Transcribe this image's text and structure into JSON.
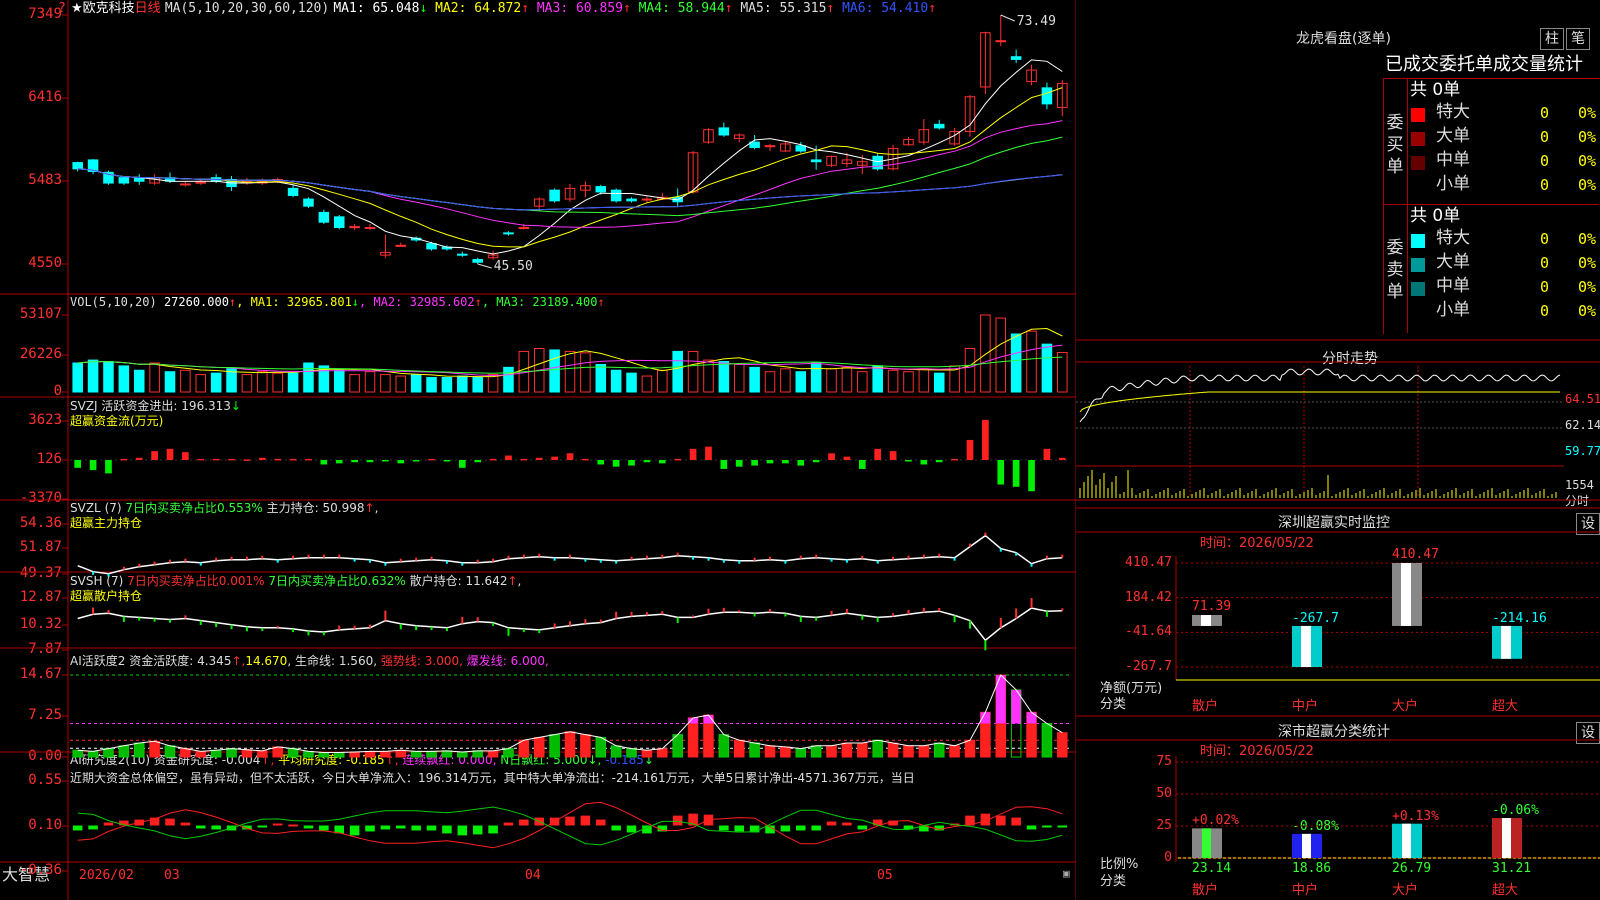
{
  "stock": {
    "star": "★",
    "name": "欧克科技",
    "period": "日线"
  },
  "main_panel": {
    "ma_title": "MA(5,10,20,30,60,120)",
    "ma": [
      {
        "label": "MA1:",
        "value": "65.048",
        "arrow": "↓",
        "color": "#ffffff"
      },
      {
        "label": "MA2:",
        "value": "64.872",
        "arrow": "↑",
        "color": "#ffff00"
      },
      {
        "label": "MA3:",
        "value": "60.859",
        "arrow": "↑",
        "color": "#ff33ff"
      },
      {
        "label": "MA4:",
        "value": "58.944",
        "arrow": "↑",
        "color": "#33ff33"
      },
      {
        "label": "MA5:",
        "value": "55.315",
        "arrow": "↑",
        "color": "#dddddd"
      },
      {
        "label": "MA6:",
        "value": "54.410",
        "arrow": "↑",
        "color": "#3355ff"
      }
    ],
    "yticks": [
      "7349",
      "6416",
      "5483",
      "4550"
    ],
    "high_label": "73.49",
    "low_label": "45.50"
  },
  "vol_panel": {
    "title": "VOL(5,10,20)",
    "value": "27260.000",
    "value_arrow": "↑",
    "ma": [
      {
        "label": "MA1:",
        "value": "32965.801",
        "arrow": "↓",
        "color": "#ffff00"
      },
      {
        "label": "MA2:",
        "value": "32985.602",
        "arrow": "↑",
        "color": "#ff33ff"
      },
      {
        "label": "MA3:",
        "value": "23189.400",
        "arrow": "↑",
        "color": "#33ff33"
      }
    ],
    "yticks": [
      "53107",
      "26226",
      "0"
    ]
  },
  "svzj_panel": {
    "code": "SVZJ",
    "label": "活跃资金进出:",
    "value": "196.313",
    "arrow": "↓",
    "subtitle": "超赢资金流(万元)",
    "yticks": [
      "3623",
      "126",
      "-3370"
    ]
  },
  "svzl_panel": {
    "code": "SVZL",
    "param": "(7)",
    "part1": "7日内买卖净占比0.553%",
    "part2": "主力持仓:",
    "value": "50.998",
    "arrow": "↑",
    "tail": ",",
    "subtitle": "超赢主力持仓",
    "yticks": [
      "54.36",
      "51.87",
      "49.37"
    ]
  },
  "svsh_panel": {
    "code": "SVSH",
    "param": "(7)",
    "part1": "7日内买卖净占比0.001%",
    "part2": "7日内买卖净占比0.632%",
    "part3": "散户持仓:",
    "value": "11.642",
    "arrow": "↑",
    "tail": ",",
    "subtitle": "超赢散户持仓",
    "yticks": [
      "12.87",
      "10.32",
      "7.87"
    ]
  },
  "ai_active_panel": {
    "title": "AI活跃度2",
    "label1": "资金活跃度:",
    "value1": "4.345",
    "value2": "14.670",
    "label3": "生命线:",
    "value3": "1.560",
    "label4": "强势线:",
    "value4": "3.000",
    "label5": "爆发线:",
    "value5": "6.000",
    "yticks": [
      "14.67",
      "7.25",
      "0.00"
    ]
  },
  "ai_research_panel": {
    "title": "AI研究度2(10)",
    "label1": "资金研究度:",
    "value1": "-0.004",
    "label2": "平均研究度:",
    "value2": "-0.185",
    "label3": "连续飘红:",
    "value3": "0.000",
    "label4": "N日飘红:",
    "value4": "5.000",
    "value5": "-0.185",
    "commentary": "近期大资金总体偏空，虽有异动，但不太活跃，今日大单净流入：196.314万元，其中特大单净流出：-214.161万元，大单5日累计净出-4571.367万元，当日",
    "yticks": [
      "0.55",
      "0.10",
      "-0.36"
    ]
  },
  "bottom_bar": {
    "brand": "大智慧",
    "dates": [
      "2026/02",
      "03",
      "04",
      "05"
    ]
  },
  "dragon": {
    "title": "龙虎看盘(逐单)",
    "btn_bar": "柱",
    "btn_pen": "笔",
    "header": "已成交委托单成交量统计",
    "buy_label": "委买单",
    "sell_label": "委卖单",
    "buy_total": "共 0单",
    "sell_total": "共 0单",
    "buy_rows": [
      {
        "name": "特大",
        "count": "0",
        "pct": "0%",
        "color": "#ff0000"
      },
      {
        "name": "大单",
        "count": "0",
        "pct": "0%",
        "color": "#990000"
      },
      {
        "name": "中单",
        "count": "0",
        "pct": "0%",
        "color": "#660000"
      },
      {
        "name": "小单",
        "count": "0",
        "pct": "0%",
        "color": ""
      }
    ],
    "sell_rows": [
      {
        "name": "特大",
        "count": "0",
        "pct": "0%",
        "color": "#00ffff"
      },
      {
        "name": "大单",
        "count": "0",
        "pct": "0%",
        "color": "#009999"
      },
      {
        "name": "中单",
        "count": "0",
        "pct": "0%",
        "color": "#007777"
      },
      {
        "name": "小单",
        "count": "0",
        "pct": "0%",
        "color": ""
      }
    ]
  },
  "intraday": {
    "title": "分时走势",
    "prices": [
      "64.51",
      "62.14",
      "59.77"
    ],
    "vol": "1554",
    "vol_unit": "分时"
  },
  "sz_monitor": {
    "title": "深圳超赢实时监控",
    "btn": "设",
    "time_label": "时间：2026/05/22",
    "yticks": [
      "410.47",
      "184.42",
      "-41.64",
      "-267.7"
    ],
    "axis_label": "净额(万元)",
    "axis_label2": "分类",
    "bars": [
      {
        "category": "散户",
        "value": 71.39,
        "label": "71.39"
      },
      {
        "category": "中户",
        "value": -267.7,
        "label": "-267.7"
      },
      {
        "category": "大户",
        "value": 410.47,
        "label": "410.47"
      },
      {
        "category": "超大",
        "value": -214.16,
        "label": "-214.16"
      }
    ]
  },
  "sz_class": {
    "title": "深市超赢分类统计",
    "btn": "设",
    "time_label": "时间：2026/05/22",
    "yticks": [
      "75",
      "50",
      "25",
      "0"
    ],
    "axis_label": "比例%",
    "axis_label2": "分类",
    "bars": [
      {
        "category": "散户",
        "value": 23.14,
        "label": "23.14",
        "change": "+0.02%"
      },
      {
        "category": "中户",
        "value": 18.86,
        "label": "18.86",
        "change": "-0.08%"
      },
      {
        "category": "大户",
        "value": 26.79,
        "label": "26.79",
        "change": "+0.13%"
      },
      {
        "category": "超大",
        "value": 31.21,
        "label": "31.21",
        "change": "-0.06%"
      }
    ]
  },
  "chart_data": [
    {
      "type": "candlestick",
      "title": "欧克科技 日线",
      "note": "values estimated from axis (price x100 scale shown on axis)",
      "x": [
        "2026/02",
        "03",
        "04",
        "05"
      ],
      "ylim": [
        4550,
        7349
      ],
      "ohlc": [
        [
          5690,
          5700,
          5590,
          5620
        ],
        [
          5720,
          5730,
          5560,
          5590
        ],
        [
          5580,
          5600,
          5440,
          5460
        ],
        [
          5520,
          5530,
          5440,
          5460
        ],
        [
          5520,
          5560,
          5440,
          5480
        ],
        [
          5460,
          5560,
          5440,
          5520
        ],
        [
          5520,
          5580,
          5460,
          5480
        ],
        [
          5440,
          5480,
          5420,
          5450
        ],
        [
          5460,
          5500,
          5440,
          5470
        ],
        [
          5520,
          5560,
          5460,
          5480
        ],
        [
          5500,
          5540,
          5370,
          5420
        ],
        [
          5460,
          5520,
          5440,
          5480
        ],
        [
          5460,
          5510,
          5440,
          5480
        ],
        [
          5480,
          5520,
          5460,
          5500
        ],
        [
          5400,
          5440,
          5300,
          5320
        ],
        [
          5280,
          5300,
          5180,
          5200
        ],
        [
          5130,
          5160,
          5000,
          5020
        ],
        [
          5080,
          5100,
          4940,
          4960
        ],
        [
          4960,
          5000,
          4930,
          4970
        ],
        [
          4950,
          5000,
          4930,
          4960
        ],
        [
          4650,
          4880,
          4620,
          4680
        ],
        [
          4760,
          4790,
          4740,
          4760
        ],
        [
          4840,
          4860,
          4800,
          4820
        ],
        [
          4780,
          4800,
          4700,
          4720
        ],
        [
          4740,
          4760,
          4700,
          4720
        ],
        [
          4660,
          4690,
          4630,
          4650
        ],
        [
          4600,
          4620,
          4550,
          4570
        ],
        [
          4620,
          4700,
          4600,
          4650
        ],
        [
          4900,
          4920,
          4870,
          4890
        ],
        [
          4960,
          5000,
          4940,
          4960
        ],
        [
          5200,
          5300,
          5150,
          5280
        ],
        [
          5380,
          5400,
          5240,
          5260
        ],
        [
          5280,
          5450,
          5250,
          5400
        ],
        [
          5380,
          5480,
          5300,
          5430
        ],
        [
          5420,
          5440,
          5330,
          5360
        ],
        [
          5380,
          5400,
          5240,
          5260
        ],
        [
          5280,
          5300,
          5240,
          5260
        ],
        [
          5270,
          5310,
          5240,
          5280
        ],
        [
          5280,
          5350,
          5270,
          5300
        ],
        [
          5300,
          5400,
          5200,
          5250
        ],
        [
          5360,
          5820,
          5340,
          5800
        ],
        [
          5920,
          6080,
          5900,
          6060
        ],
        [
          6080,
          6140,
          5980,
          6000
        ],
        [
          5960,
          6020,
          5920,
          6000
        ],
        [
          5920,
          6000,
          5840,
          5860
        ],
        [
          5880,
          5900,
          5820,
          5880
        ],
        [
          5820,
          5930,
          5810,
          5900
        ],
        [
          5880,
          5920,
          5800,
          5820
        ],
        [
          5720,
          5880,
          5610,
          5700
        ],
        [
          5660,
          5770,
          5640,
          5760
        ],
        [
          5680,
          5800,
          5640,
          5720
        ],
        [
          5660,
          5780,
          5560,
          5700
        ],
        [
          5760,
          5800,
          5600,
          5620
        ],
        [
          5620,
          5890,
          5600,
          5850
        ],
        [
          5890,
          5980,
          5880,
          5950
        ],
        [
          5920,
          6180,
          5890,
          6060
        ],
        [
          6120,
          6170,
          6060,
          6080
        ],
        [
          5900,
          6080,
          5880,
          6040
        ],
        [
          6040,
          6450,
          5980,
          6430
        ],
        [
          6540,
          7160,
          6460,
          7150
        ],
        [
          7050,
          7349,
          7000,
          7060
        ],
        [
          6880,
          6960,
          6810,
          6850
        ],
        [
          6600,
          6790,
          6560,
          6730
        ],
        [
          6530,
          6590,
          6290,
          6350
        ],
        [
          6310,
          6620,
          6210,
          6580
        ]
      ]
    },
    {
      "type": "bar",
      "title": "VOL(5,10,20)",
      "ylim": [
        0,
        53107
      ],
      "values": [
        20000,
        22000,
        21000,
        18000,
        15000,
        20000,
        14000,
        15000,
        12000,
        13000,
        16000,
        12000,
        14000,
        13000,
        13000,
        20000,
        18000,
        15000,
        12000,
        14000,
        12000,
        11000,
        12000,
        10000,
        10000,
        11000,
        10000,
        12000,
        17000,
        28000,
        30000,
        29000,
        28000,
        27000,
        19000,
        15000,
        13000,
        11000,
        15000,
        28000,
        28000,
        22000,
        21000,
        19000,
        17000,
        14000,
        16000,
        14000,
        20000,
        16000,
        17000,
        14000,
        18000,
        15000,
        14000,
        16000,
        13000,
        18000,
        30000,
        53107,
        51000,
        40000,
        42000,
        33000,
        27260
      ]
    },
    {
      "type": "bar",
      "title": "SVZJ 活跃资金进出",
      "ylim": [
        -3370,
        3623
      ],
      "values": [
        -700,
        -900,
        -1200,
        100,
        200,
        800,
        1000,
        700,
        100,
        100,
        100,
        50,
        200,
        100,
        100,
        100,
        -400,
        -300,
        -200,
        -200,
        -100,
        -300,
        -50,
        100,
        -100,
        -700,
        -200,
        100,
        400,
        100,
        200,
        300,
        600,
        100,
        -400,
        -600,
        -500,
        -200,
        -300,
        100,
        1000,
        1200,
        -800,
        -600,
        -500,
        -300,
        -300,
        -500,
        -200,
        600,
        300,
        -800,
        1000,
        800,
        -100,
        -400,
        -200,
        100,
        1800,
        3600,
        -2200,
        -2400,
        -2800,
        1000,
        196
      ]
    },
    {
      "type": "line",
      "title": "SVZL 主力持仓",
      "ylim": [
        49.37,
        54.36
      ],
      "values": [
        50.2,
        49.6,
        49.4,
        49.8,
        50.1,
        50.3,
        50.5,
        50.6,
        50.5,
        50.7,
        50.8,
        50.8,
        50.9,
        50.8,
        50.9,
        51.0,
        51.0,
        51.0,
        50.9,
        50.8,
        50.5,
        50.6,
        50.7,
        50.8,
        50.7,
        50.5,
        50.5,
        50.6,
        50.9,
        51.0,
        51.1,
        51.0,
        51.0,
        50.9,
        50.8,
        50.7,
        50.8,
        50.9,
        51.0,
        51.2,
        51.1,
        51.0,
        50.8,
        50.7,
        50.7,
        50.8,
        50.7,
        50.9,
        51.0,
        50.9,
        50.8,
        50.9,
        50.7,
        50.8,
        50.9,
        51.0,
        51.1,
        51.0,
        52.1,
        53.2,
        51.9,
        51.5,
        50.4,
        50.9,
        51.0
      ]
    },
    {
      "type": "line",
      "title": "SVSH 散户持仓",
      "ylim": [
        7.87,
        12.87
      ],
      "values": [
        10.9,
        11.3,
        11.4,
        11.1,
        11.0,
        10.9,
        10.8,
        10.9,
        10.7,
        10.5,
        10.3,
        10.1,
        10.0,
        10.0,
        9.9,
        9.7,
        9.6,
        9.8,
        9.9,
        10.0,
        10.7,
        10.4,
        10.2,
        10.1,
        10.0,
        10.4,
        10.6,
        10.5,
        10.0,
        9.9,
        9.8,
        10.0,
        10.2,
        10.4,
        10.5,
        10.9,
        11.1,
        11.2,
        11.3,
        11.0,
        11.0,
        11.3,
        11.5,
        11.5,
        11.4,
        11.5,
        11.4,
        11.1,
        11.0,
        11.2,
        11.4,
        11.2,
        11.0,
        11.1,
        11.3,
        11.5,
        11.6,
        11.2,
        10.7,
        8.8,
        10.0,
        10.9,
        11.9,
        11.6,
        11.642
      ]
    },
    {
      "type": "bar",
      "title": "AI活跃度2 资金活跃度",
      "ylim": [
        0,
        14.67
      ],
      "values": [
        1.2,
        1.0,
        1.5,
        2.0,
        2.5,
        2.8,
        2.0,
        1.5,
        1.0,
        1.2,
        1.5,
        1.3,
        1.1,
        1.8,
        1.5,
        1.0,
        0.8,
        0.8,
        0.9,
        1.0,
        1.0,
        1.2,
        1.0,
        1.0,
        1.1,
        0.9,
        1.1,
        1.1,
        1.5,
        3.0,
        3.5,
        4.0,
        4.5,
        4.0,
        3.5,
        2.0,
        1.5,
        1.2,
        1.5,
        4.0,
        7.0,
        7.5,
        4.0,
        3.0,
        2.5,
        2.0,
        1.8,
        1.5,
        2.0,
        2.0,
        2.5,
        2.5,
        3.0,
        2.5,
        2.0,
        2.0,
        2.5,
        2.0,
        3.0,
        8.0,
        14.67,
        12.0,
        8.0,
        6.0,
        4.345
      ]
    },
    {
      "type": "bar",
      "title": "AI研究度2 资金研究度",
      "ylim": [
        -0.36,
        0.55
      ],
      "values": [
        -0.05,
        -0.04,
        0.03,
        0.05,
        0.06,
        0.08,
        0.07,
        0.03,
        -0.03,
        -0.04,
        -0.05,
        -0.04,
        -0.02,
        0.02,
        0.01,
        -0.03,
        -0.05,
        -0.08,
        -0.1,
        -0.06,
        -0.04,
        -0.03,
        -0.05,
        -0.05,
        -0.08,
        -0.1,
        -0.09,
        -0.08,
        0.03,
        0.06,
        0.08,
        0.08,
        0.09,
        0.1,
        0.06,
        -0.05,
        -0.07,
        -0.08,
        -0.06,
        0.1,
        0.12,
        0.11,
        -0.05,
        -0.06,
        -0.07,
        -0.08,
        -0.06,
        -0.05,
        -0.05,
        0.04,
        0.03,
        -0.04,
        0.06,
        0.05,
        -0.04,
        -0.06,
        -0.05,
        0.02,
        0.1,
        0.12,
        0.1,
        0.08,
        -0.04,
        -0.02,
        -0.004
      ]
    }
  ]
}
